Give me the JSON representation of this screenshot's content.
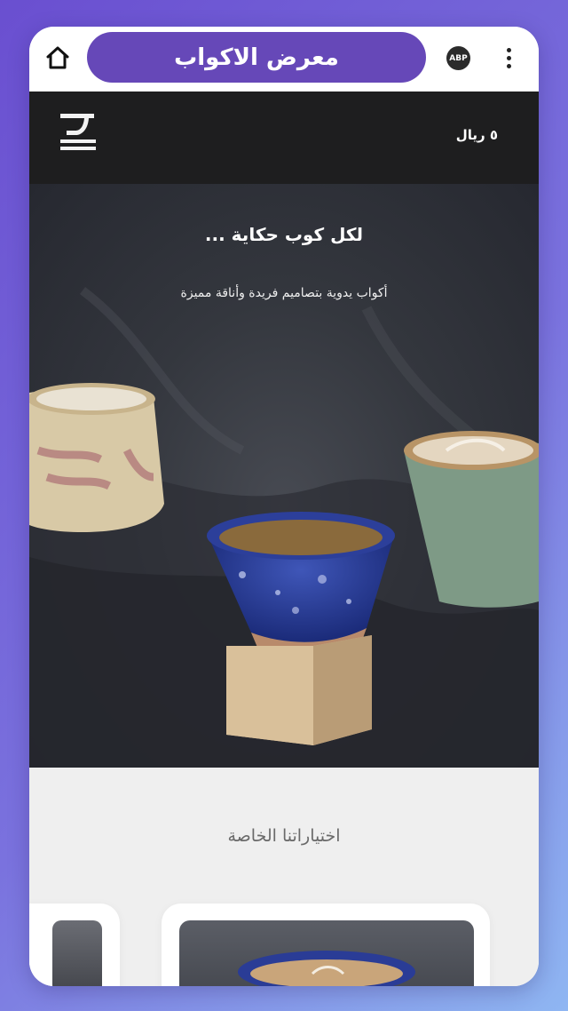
{
  "browser": {
    "title": "معرض الاكواب",
    "adblock_label": "ABP",
    "icons": [
      "home-icon",
      "adblock-icon",
      "more-vert-icon"
    ]
  },
  "header": {
    "cart_total": "٥ ريال",
    "logo_icon": "cup-logo-icon"
  },
  "hero": {
    "title": "لكل كوب حكاية ...",
    "subtitle": "أكواب يدوية بتصاميم فريدة وأناقة مميزة"
  },
  "featured": {
    "title": "اختياراتنا الخاصة"
  },
  "colors": {
    "accent": "#6648b8",
    "header_bg": "#1e1e1f",
    "section_bg": "#efefef"
  }
}
